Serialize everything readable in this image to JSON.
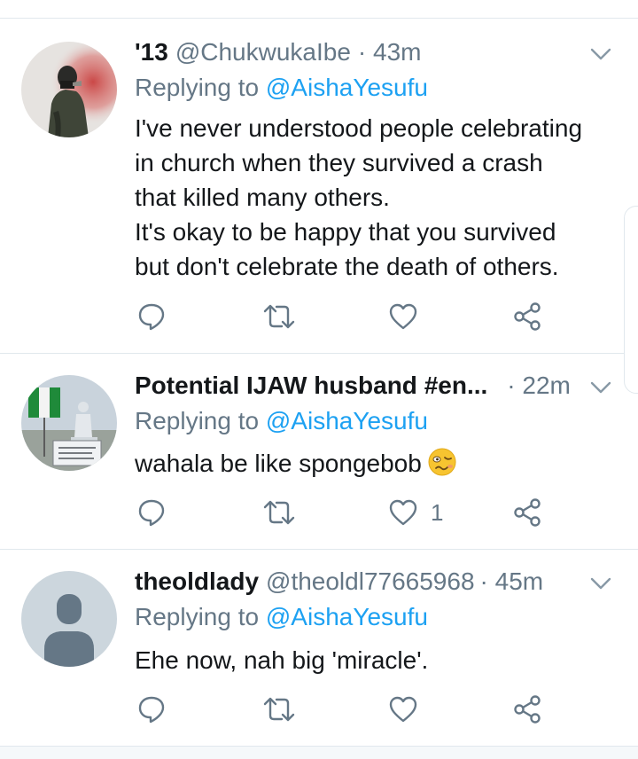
{
  "tweets": [
    {
      "display_name": "'13",
      "handle": "@ChukwukaIbe",
      "time": "· 43m",
      "replying_prefix": "Replying to",
      "replying_to": "@AishaYesufu",
      "body_lines": [
        "I've never understood people celebrating",
        "in church when they survived a crash",
        "that killed many others.",
        "It's okay to be happy that you survived",
        "but don't celebrate the death of others."
      ],
      "like_count": "",
      "avatar_icon": "person-with-red-smoke-avatar"
    },
    {
      "display_name": "Potential IJAW husband #en...",
      "handle": "",
      "time": "· 22m",
      "replying_prefix": "Replying to",
      "replying_to": "@AishaYesufu",
      "body_lines": [
        "wahala be like spongebob"
      ],
      "emoji": "woozy-face-emoji",
      "like_count": "1",
      "avatar_icon": "flag-and-statue-avatar"
    },
    {
      "display_name": "theoldlady",
      "handle": "@theoldl77665968",
      "time": "· 45m",
      "replying_prefix": "Replying to",
      "replying_to": "@AishaYesufu",
      "body_lines": [
        "Ehe now, nah big 'miracle'."
      ],
      "like_count": "",
      "avatar_icon": "default-profile-avatar"
    }
  ],
  "colors": {
    "text": "#14171a",
    "muted": "#657786",
    "link": "#1da1f2",
    "divider": "#e1e8ed"
  }
}
